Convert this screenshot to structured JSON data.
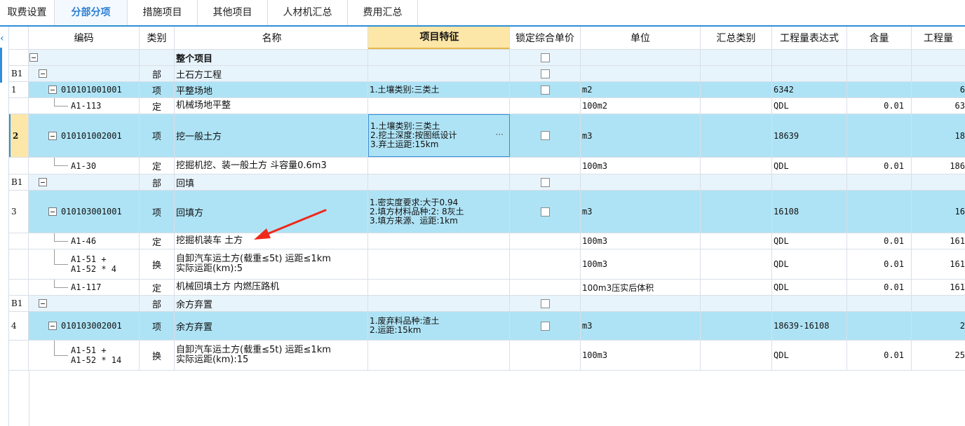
{
  "tabs": [
    "取费设置",
    "分部分项",
    "措施项目",
    "其他项目",
    "人材机汇总",
    "费用汇总"
  ],
  "active_tab": 1,
  "columns": {
    "code": "编码",
    "type": "类别",
    "name": "名称",
    "feature": "项目特征",
    "lock": "锁定综合单价",
    "unit": "单位",
    "summary": "汇总类别",
    "expr": "工程量表达式",
    "content": "含量",
    "amount": "工程量"
  },
  "rows": [
    {
      "idx": "",
      "code": "",
      "type": "",
      "name": "整个项目",
      "feature": [],
      "unit": "",
      "expr": "",
      "qty": "",
      "amt": ""
    },
    {
      "idx": "B1",
      "code": "",
      "type": "部",
      "name": "土石方工程",
      "feature": [],
      "unit": "",
      "expr": "",
      "qty": "",
      "amt": ""
    },
    {
      "idx": "1",
      "code": "010101001001",
      "type": "项",
      "name": "平整场地",
      "feature": [
        "1.土壤类别:三类土"
      ],
      "unit": "m2",
      "expr": "6342",
      "qty": "",
      "amt": "6"
    },
    {
      "idx": "",
      "code": "A1-113",
      "type": "定",
      "name": "机械场地平整",
      "feature": [],
      "unit": "100m2",
      "expr": "QDL",
      "qty": "0.01",
      "amt": "63"
    },
    {
      "idx": "2",
      "code": "010101002001",
      "type": "项",
      "name": "挖一般土方",
      "feature": [
        "1.土壤类别:三类土",
        "2.挖土深度:按图纸设计",
        "3.弃土运距:15km"
      ],
      "unit": "m3",
      "expr": "18639",
      "qty": "",
      "amt": "18"
    },
    {
      "idx": "",
      "code": "A1-30",
      "type": "定",
      "name": "挖掘机挖、装一般土方 斗容量0.6m3",
      "feature": [],
      "unit": "100m3",
      "expr": "QDL",
      "qty": "0.01",
      "amt": "186"
    },
    {
      "idx": "B1",
      "code": "",
      "type": "部",
      "name": "回填",
      "feature": [],
      "unit": "",
      "expr": "",
      "qty": "",
      "amt": ""
    },
    {
      "idx": "3",
      "code": "010103001001",
      "type": "项",
      "name": "回填方",
      "feature": [
        "1.密实度要求:大于0.94",
        "2.填方材料品种:2: 8灰土",
        "3.填方来源、运距:1km"
      ],
      "unit": "m3",
      "expr": "16108",
      "qty": "",
      "amt": "16"
    },
    {
      "idx": "",
      "code": "A1-46",
      "type": "定",
      "name": "挖掘机装车 土方",
      "feature": [],
      "unit": "100m3",
      "expr": "QDL",
      "qty": "0.01",
      "amt": "161"
    },
    {
      "idx": "",
      "code": "A1-51 +",
      "code2": "A1-52 * 4",
      "type": "换",
      "name": "自卸汽车运土方(载重≤5t) 运距≤1km",
      "name2": "实际运距(km):5",
      "feature": [],
      "unit": "100m3",
      "expr": "QDL",
      "qty": "0.01",
      "amt": "161"
    },
    {
      "idx": "",
      "code": "A1-117",
      "type": "定",
      "name": "机械回填土方 内燃压路机",
      "feature": [],
      "unit": "100m3压实后体积",
      "expr": "QDL",
      "qty": "0.01",
      "amt": "161"
    },
    {
      "idx": "B1",
      "code": "",
      "type": "部",
      "name": "余方弃置",
      "feature": [],
      "unit": "",
      "expr": "",
      "qty": "",
      "amt": ""
    },
    {
      "idx": "4",
      "code": "010103002001",
      "type": "项",
      "name": "余方弃置",
      "feature": [
        "1.废弃料品种:渣土",
        "2.运距:15km"
      ],
      "unit": "m3",
      "expr": "18639-16108",
      "qty": "",
      "amt": "2"
    },
    {
      "idx": "",
      "code": "A1-51 +",
      "code2": "A1-52 * 14",
      "type": "换",
      "name": "自卸汽车运土方(载重≤5t) 运距≤1km",
      "name2": "实际运距(km):15",
      "feature": [],
      "unit": "100m3",
      "expr": "QDL",
      "qty": "0.01",
      "amt": "25"
    }
  ],
  "annotation": {
    "kind": "arrow-icon",
    "color": "#ee2a1b"
  },
  "colors": {
    "accent": "#2f8fd8",
    "item_row": "#aee3f5",
    "part_row": "#e8f4fb",
    "highlight_header": "#fde7a8"
  }
}
